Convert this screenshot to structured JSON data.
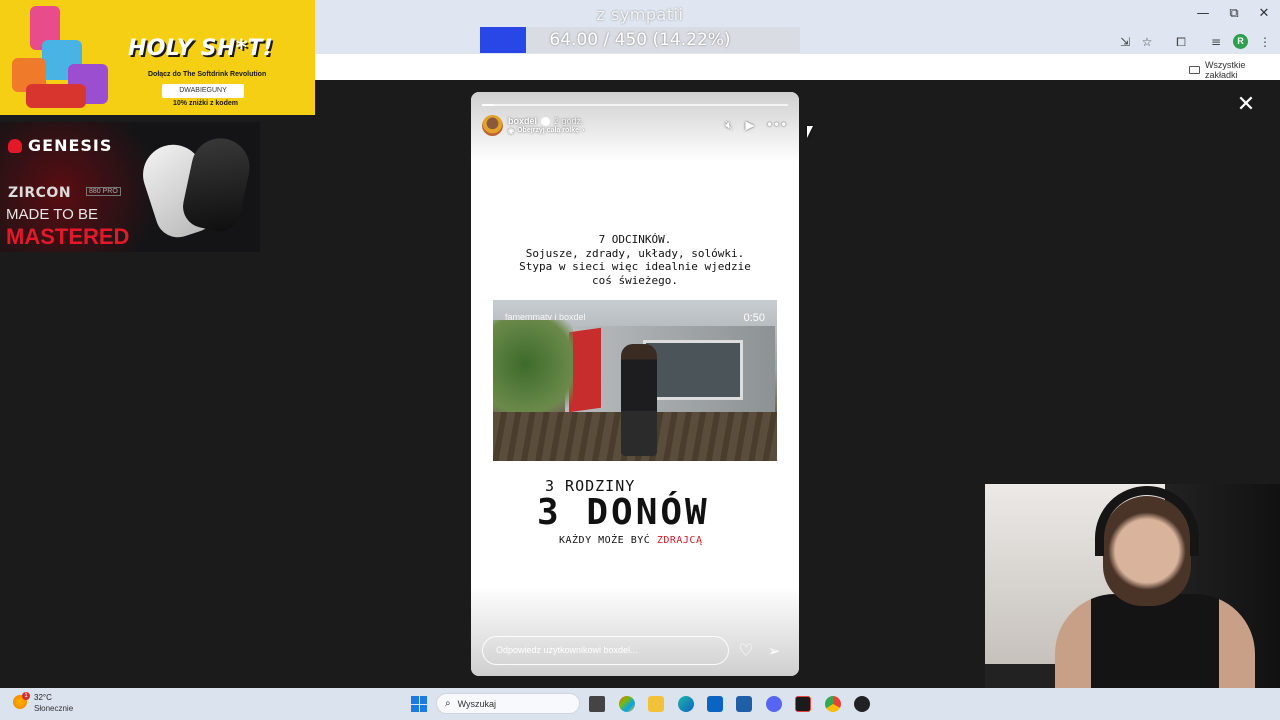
{
  "browser": {
    "bookmarks_all_label": "Wszystkie zakładki",
    "profile_initial": "R",
    "window_controls": {
      "minimize": "—",
      "restore": "⧉",
      "close": "✕"
    },
    "toolbar_icons": [
      "install-icon",
      "star-icon",
      "extensions-icon",
      "media-icon",
      "profile-avatar",
      "menu-icon"
    ]
  },
  "donation_goal": {
    "title": "z sympatii",
    "progress_text": "64.00 / 450 (14.22%)",
    "fraction": 0.1422,
    "fill_color": "#2946e6"
  },
  "ads": {
    "holy": {
      "title": "HOLY SH*T!",
      "subtitle": "Dołącz do The Softdrink Revolution",
      "code": "DWABIEGUNY",
      "discount": "10% zniżki z kodem"
    },
    "genesis": {
      "brand": "GENESIS",
      "product": "ZIRCON",
      "model": "880 PRO",
      "tagline_1": "MADE TO BE",
      "tagline_2": "MASTERED"
    }
  },
  "story": {
    "username": "boxdel",
    "time": "2 godz.",
    "reel_link": "Obejrzyj całą rolkę",
    "progress_fraction": 0.04,
    "text_lines": [
      "7 ODCINKÓW.",
      "Sojusze, zdrady, układy, solówki.",
      "Stypa w sieci więc idealnie wjedzie",
      "coś świeżego."
    ],
    "video_caption": "famemmatv i boxdel",
    "video_duration": "0:50",
    "families": "3 RODZINY",
    "dons": "3 DONÓW",
    "traitor_prefix": "KAŻDY MOŻE BYĆ",
    "traitor_word": "ZDRAJCĄ",
    "reply_placeholder": "Odpowiedz użytkownikowi boxdel...",
    "accent_red": "#d01d23"
  },
  "taskbar": {
    "weather_temp": "32°C",
    "weather_desc": "Słonecznie",
    "weather_badge": "1",
    "search_placeholder": "Wyszukaj"
  }
}
